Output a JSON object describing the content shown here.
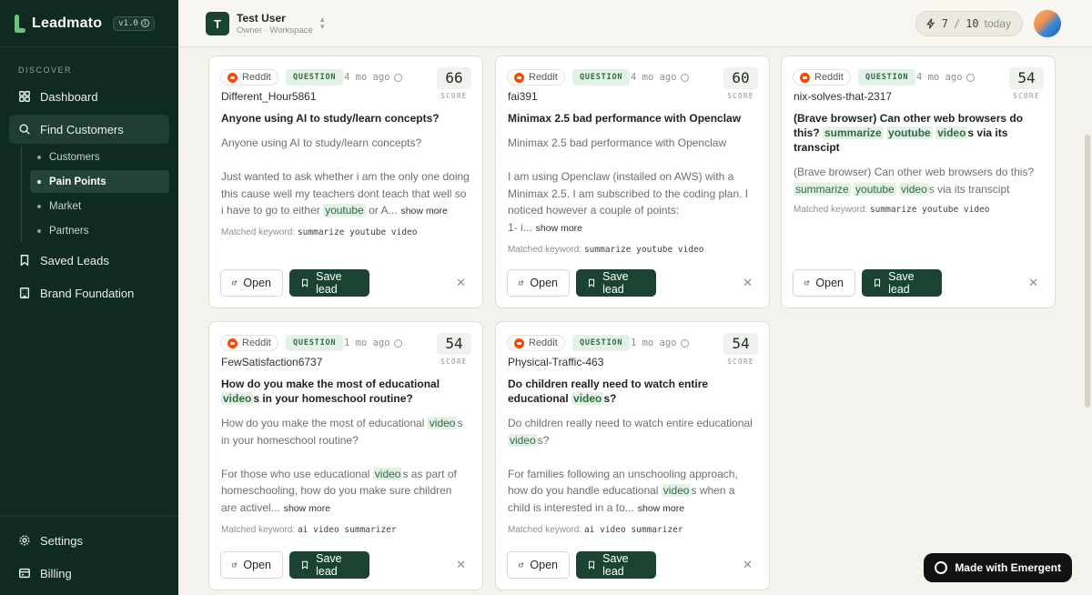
{
  "app": {
    "name": "Leadmato",
    "version": "v1.0"
  },
  "sidebar": {
    "section": "DISCOVER",
    "items": [
      {
        "label": "Dashboard",
        "icon": "dashboard-icon"
      },
      {
        "label": "Find Customers",
        "icon": "search-icon",
        "active": true
      },
      {
        "label": "Saved Leads",
        "icon": "bookmark-icon"
      },
      {
        "label": "Brand Foundation",
        "icon": "building-icon"
      }
    ],
    "subitems": [
      {
        "label": "Customers"
      },
      {
        "label": "Pain Points",
        "active": true
      },
      {
        "label": "Market"
      },
      {
        "label": "Partners"
      }
    ],
    "bottom": [
      {
        "label": "Settings",
        "icon": "gear-icon"
      },
      {
        "label": "Billing",
        "icon": "credit-card-icon"
      }
    ]
  },
  "header": {
    "workspace_initial": "T",
    "user_name": "Test User",
    "user_role": "Owner · Workspace",
    "credits_used": "7",
    "credits_sep": "/",
    "credits_total": "10",
    "credits_period": "today"
  },
  "cards": [
    {
      "source": "Reddit",
      "tag": "QUESTION",
      "ago": "4 mo ago",
      "score": "66",
      "score_label": "SCORE",
      "author": "Different_Hour5861",
      "title": "Anyone using AI to study/learn concepts?",
      "p1": "Anyone using AI to study/learn concepts?",
      "p2a": "Just wanted to ask whether i am the only one doing this cause well my teachers dont teach that well so i have to go to either ",
      "p2hl": "youtube",
      "p2b": " or A...",
      "more": "show more",
      "kw_label": "Matched keyword:",
      "kw": "summarize youtube video",
      "open": "Open",
      "save": "Save lead"
    },
    {
      "source": "Reddit",
      "tag": "QUESTION",
      "ago": "4 mo ago",
      "score": "60",
      "score_label": "SCORE",
      "author": "fai391",
      "title": "Minimax 2.5 bad performance with Openclaw",
      "p1": "Minimax 2.5 bad performance with Openclaw",
      "p2a": "I am using Openclaw (installed on AWS) with a Minimax 2.5. I am subscribed to the coding plan. I noticed however a couple of points:",
      "p3": "1- i...",
      "more": "show more",
      "kw_label": "Matched keyword:",
      "kw": "summarize youtube video",
      "open": "Open",
      "save": "Save lead"
    },
    {
      "source": "Reddit",
      "tag": "QUESTION",
      "ago": "4 mo ago",
      "score": "54",
      "score_label": "SCORE",
      "author": "nix-solves-that-2317",
      "title_a": "(Brave browser) Can other web browsers do this? ",
      "title_hl1": "summarize",
      "title_hl2": "youtube",
      "title_hl3": "video",
      "title_b": "s via its transcipt",
      "body_a": "(Brave browser) Can other web browsers do this? ",
      "body_hl1": "summarize",
      "body_hl2": "youtube",
      "body_hl3": "video",
      "body_b": "s via its transcipt",
      "kw_label": "Matched keyword:",
      "kw": "summarize youtube video",
      "open": "Open",
      "save": "Save lead"
    },
    {
      "source": "Reddit",
      "tag": "QUESTION",
      "ago": "1 mo ago",
      "score": "54",
      "score_label": "SCORE",
      "author": "FewSatisfaction6737",
      "title_a": "How do you make the most of educational ",
      "title_hl": "video",
      "title_b": "s in your homeschool routine?",
      "p1a": "How do you make the most of educational ",
      "p1hl": "video",
      "p1b": "s in your homeschool routine?",
      "p2a": "For those who use educational ",
      "p2hl": "video",
      "p2b": "s as part of homeschooling, how do you make sure children are activel...",
      "more": "show more",
      "kw_label": "Matched keyword:",
      "kw": "ai video summarizer",
      "open": "Open",
      "save": "Save lead"
    },
    {
      "source": "Reddit",
      "tag": "QUESTION",
      "ago": "1 mo ago",
      "score": "54",
      "score_label": "SCORE",
      "author": "Physical-Traffic-463",
      "title_a": "Do children really need to watch entire educational ",
      "title_hl": "video",
      "title_b": "s?",
      "p1a": "Do children really need to watch entire educational ",
      "p1hl": "video",
      "p1b": "s?",
      "p2a": "For families following an unschooling approach, how do you handle educational ",
      "p2hl": "video",
      "p2b": "s when a child is interested in a to...",
      "more": "show more",
      "kw_label": "Matched keyword:",
      "kw": "ai video summarizer",
      "open": "Open",
      "save": "Save lead"
    }
  ],
  "badge": {
    "label": "Made with Emergent"
  },
  "colors": {
    "sidebar_bg": "#0f2a20",
    "accent": "#1b4332",
    "highlight_bg": "#e3f1e6",
    "reddit": "#ff4500"
  }
}
